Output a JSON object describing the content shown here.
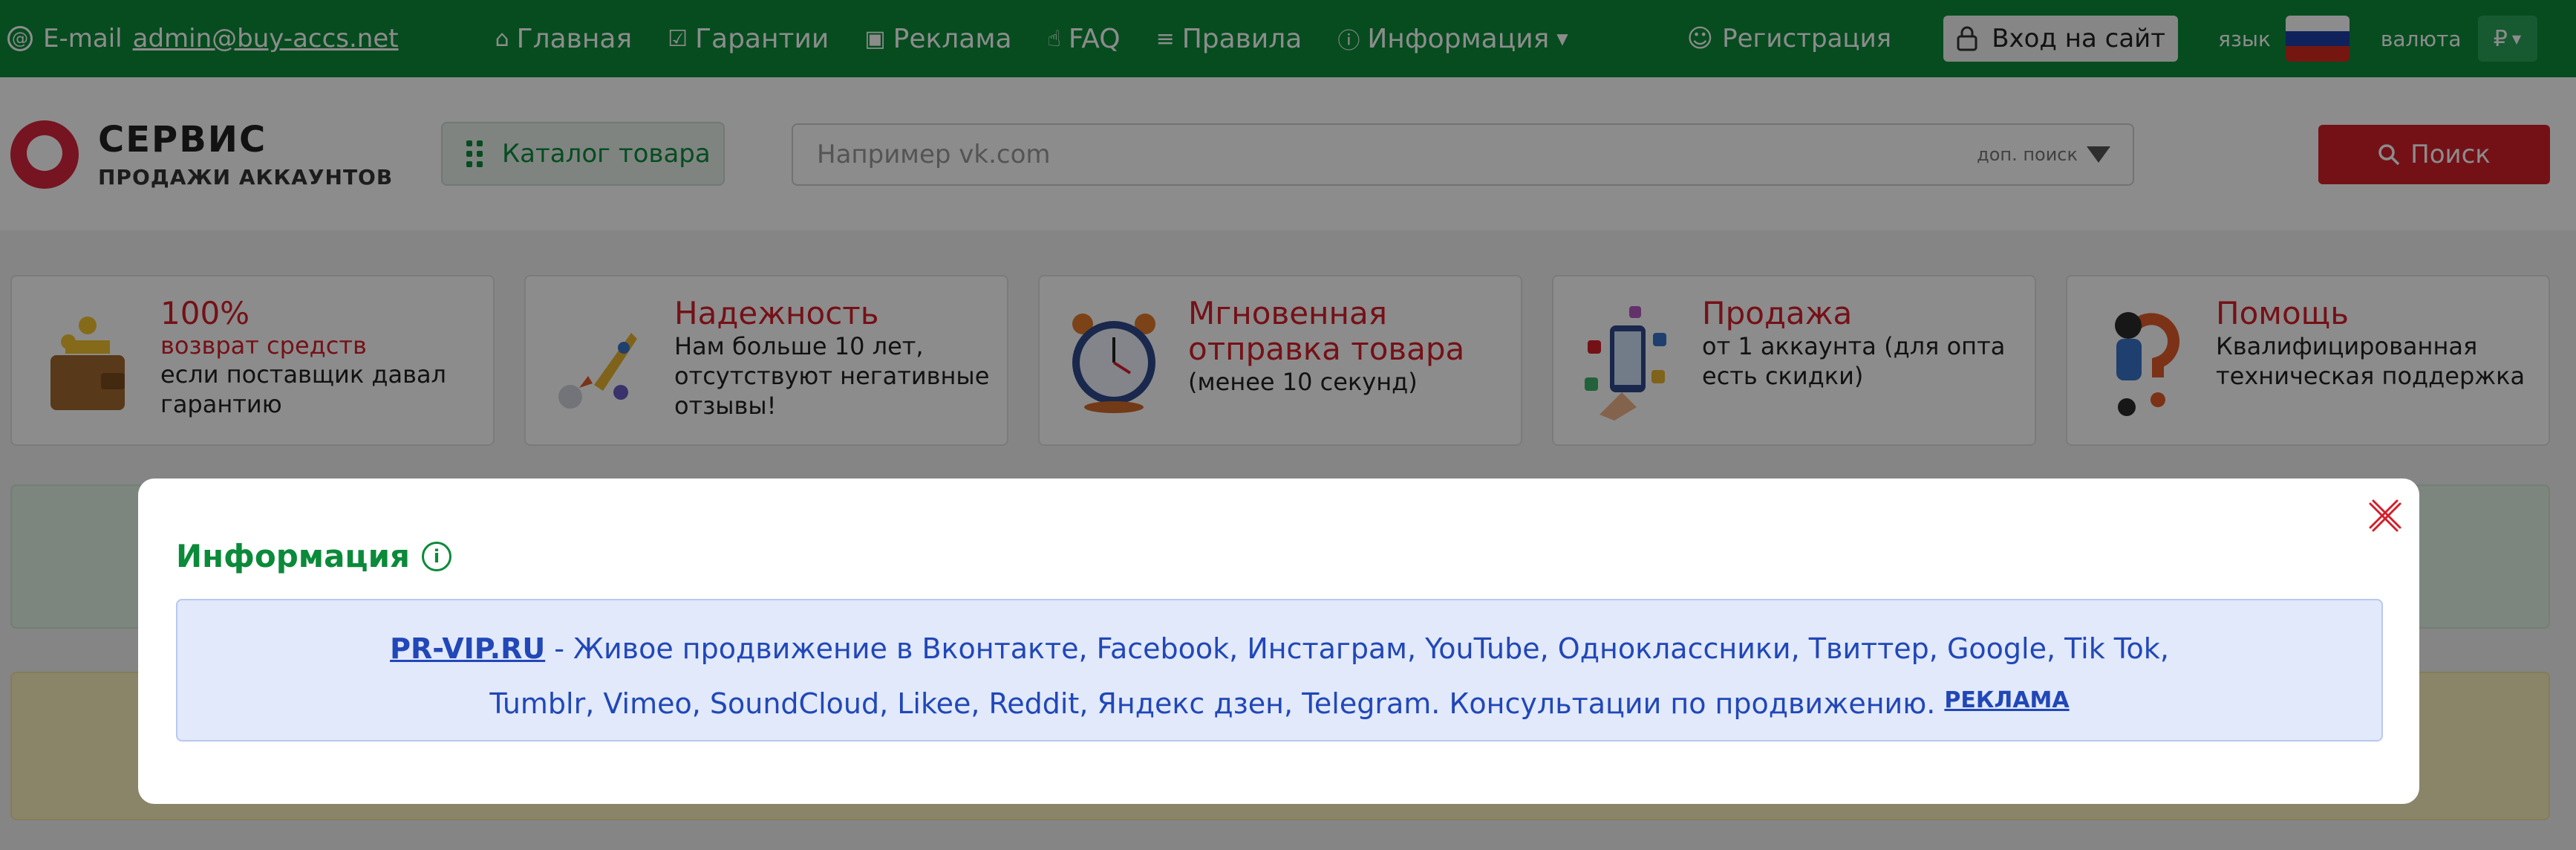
{
  "topbar": {
    "email_prefix": "E-mail",
    "email": "admin@buy-accs.net",
    "nav": [
      {
        "label": "Главная",
        "icon": "home-icon"
      },
      {
        "label": "Гарантии",
        "icon": "check-square-icon"
      },
      {
        "label": "Реклама",
        "icon": "chat-icon"
      },
      {
        "label": "FAQ",
        "icon": "hand-pointer-icon"
      },
      {
        "label": "Правила",
        "icon": "list-check-icon"
      },
      {
        "label": "Информация",
        "icon": "info-icon"
      }
    ],
    "register": "Регистрация",
    "login": "Вход на сайт",
    "lang_label": "язык",
    "currency_label": "валюта",
    "currency_symbol": "₽"
  },
  "header": {
    "logo_line1": "СЕРВИС",
    "logo_line2": "ПРОДАЖИ АККАУНТОВ",
    "catalog": "Каталог товара",
    "search_placeholder": "Например vk.com",
    "advanced": "доп. поиск",
    "search_button": "Поиск"
  },
  "features": [
    {
      "title": "100%",
      "sub": "возврат средств",
      "desc": "если поставщик давал гарантию"
    },
    {
      "title": "Надежность",
      "sub": "",
      "desc": "Нам больше 10 лет, отсутствуют негативные отзывы!"
    },
    {
      "title": "Мгновенная отправка товара",
      "sub": "",
      "desc": "(менее 10 секунд)"
    },
    {
      "title": "Продажа",
      "sub": "",
      "desc": "от 1 аккаунта (для опта есть скидки)"
    },
    {
      "title": "Помощь",
      "sub": "",
      "desc": "Квалифицированная техническая поддержка"
    }
  ],
  "modal": {
    "title": "Информация",
    "ad_link": "PR-VIP.RU",
    "ad_line1": " - Живое продвижение в Вконтакте, Facebook, Инстаграм, YouTube, Одноклассники, Твиттер, Google, Tik Tok,",
    "ad_line2": "Tumblr, Vimeo, SoundCloud, Likee, Reddit, Яндекс дзен, Telegram. Консультации по продвижению. ",
    "ad_tag": "РЕКЛАМА"
  },
  "colors": {
    "brand_green": "#0b8a3a",
    "accent_red": "#d41f2a",
    "ad_blue": "#2147b8"
  }
}
